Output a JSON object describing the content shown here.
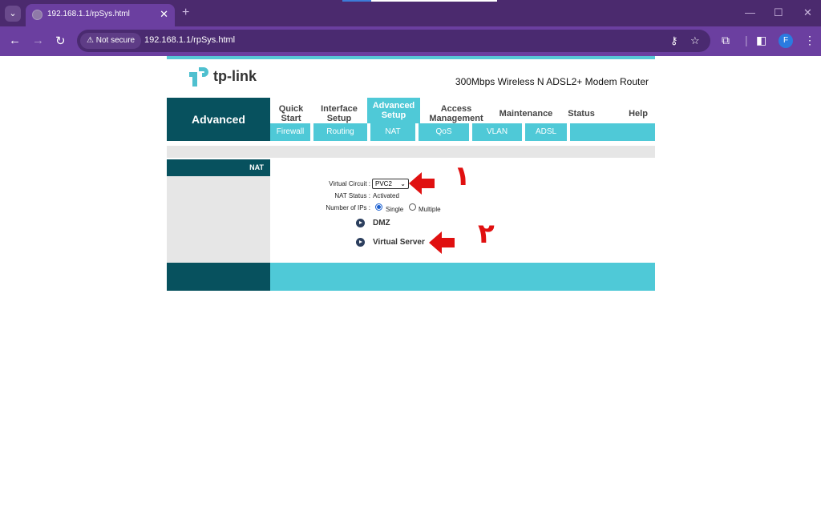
{
  "browser": {
    "tab_title": "192.168.1.1/rpSys.html",
    "not_secure_label": "Not secure",
    "url": "192.168.1.1/rpSys.html",
    "profile_initial": "F",
    "icons": {
      "tab_list": "chevron-down-icon",
      "close": "close-icon",
      "new_tab": "plus-icon",
      "back": "arrow-left-icon",
      "forward": "arrow-right-icon",
      "reload": "reload-icon",
      "warning": "warning-icon",
      "key": "key-icon",
      "star": "star-icon",
      "extensions": "puzzle-icon",
      "side_panel": "side-panel-icon",
      "menu": "more-vert-icon"
    },
    "colors": {
      "tabbar": "#4b2a6e",
      "toolbar": "#6b3fa0",
      "profile": "#2a7be0"
    }
  },
  "router": {
    "brand": "tp-link",
    "model": "300Mbps Wireless N ADSL2+ Modem Router",
    "section": "Advanced",
    "menu": [
      {
        "line1": "Quick",
        "line2": "Start"
      },
      {
        "line1": "Interface",
        "line2": "Setup"
      },
      {
        "line1": "Advanced",
        "line2": "Setup"
      },
      {
        "line1": "Access",
        "line2": "Management"
      },
      {
        "line1": "Maintenance",
        "line2": ""
      },
      {
        "line1": "Status",
        "line2": ""
      },
      {
        "line1": "Help",
        "line2": ""
      }
    ],
    "active_menu": "Advanced Setup",
    "submenu": [
      "Firewall",
      "Routing",
      "NAT",
      "QoS",
      "VLAN",
      "ADSL"
    ],
    "side_title": "NAT",
    "form": {
      "virtual_circuit_label": "Virtual Circuit :",
      "virtual_circuit_value": "PVC2",
      "nat_status_label": "NAT Status :",
      "nat_status_value": "Activated",
      "num_ips_label": "Number of IPs :",
      "option_single": "Single",
      "option_multiple": "Multiple",
      "selected_option": "Single"
    },
    "links": {
      "dmz": "DMZ",
      "virtual_server": "Virtual Server"
    },
    "colors": {
      "dark_teal": "#07515e",
      "light_teal": "#4fc9d7",
      "gray": "#e6e6e6"
    }
  },
  "annotations": [
    {
      "number": "١"
    },
    {
      "number": "٢"
    }
  ]
}
